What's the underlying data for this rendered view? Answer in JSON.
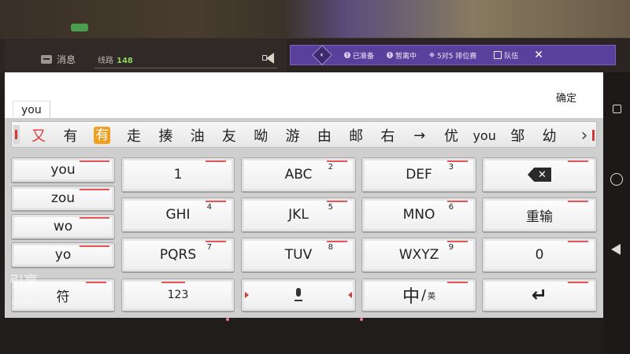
{
  "game_header": {
    "message_label": "消息",
    "route_label": "线路",
    "route_number": "148",
    "status_ready": "已准备",
    "status_away": "暂离中",
    "match_mode": "5对5 排位赛",
    "team_label": "队伍"
  },
  "input": {
    "typed_text": "you",
    "confirm_label": "确定"
  },
  "candidates": [
    "又",
    "有",
    "有",
    "走",
    "揍",
    "油",
    "友",
    "呦",
    "游",
    "由",
    "邮",
    "右",
    "→",
    "优",
    "you",
    "邹",
    "幼"
  ],
  "keyboard": {
    "side_suggestions": [
      "you",
      "zou",
      "wo",
      "yo"
    ],
    "symbol_key": "符",
    "rows": [
      [
        {
          "label": "1",
          "num": ""
        },
        {
          "label": "ABC",
          "num": "2"
        },
        {
          "label": "DEF",
          "num": "3"
        }
      ],
      [
        {
          "label": "GHI",
          "num": "4"
        },
        {
          "label": "JKL",
          "num": "5"
        },
        {
          "label": "MNO",
          "num": "6"
        }
      ],
      [
        {
          "label": "PQRS",
          "num": "7"
        },
        {
          "label": "TUV",
          "num": "8"
        },
        {
          "label": "WXYZ",
          "num": "9"
        }
      ]
    ],
    "backspace_glyph": "✕",
    "reenter_label": "重输",
    "zero_label": "0",
    "numbers_label": "123",
    "lang_main": "中",
    "lang_slash": "/",
    "lang_alt": "英",
    "enter_glyph": "↵"
  },
  "watermark": {
    "logo_text": "引享",
    "small_text": "引享游戏网"
  },
  "colors": {
    "accent_red": "#e25757",
    "candidate_highlight": "#f0a020",
    "purple_bar": "#5a3f9c",
    "route_green": "#8fd25a"
  }
}
